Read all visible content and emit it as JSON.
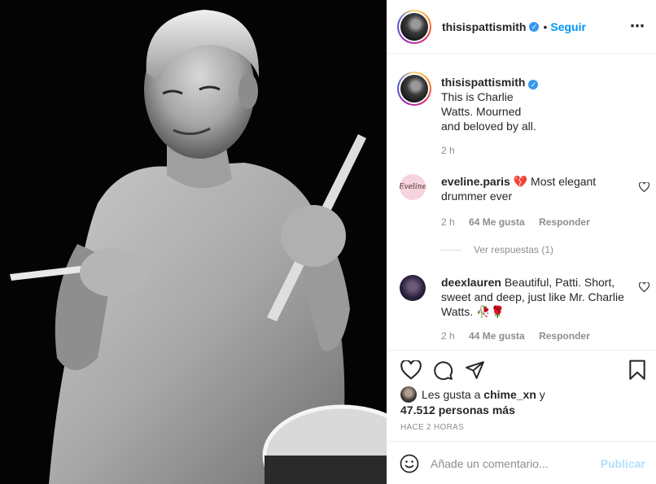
{
  "post": {
    "username": "thisispattismith",
    "verified_mark": "✓",
    "dot": "•",
    "follow_label": "Seguir",
    "more_icon": "⋯",
    "caption_text": "This is Charlie Watts. Mourned and beloved by all.",
    "caption_time": "2 h"
  },
  "comments": [
    {
      "username": "eveline.paris",
      "text": "💔 Most elegant drummer ever",
      "time": "2 h",
      "likes": "64 Me gusta",
      "reply_label": "Responder",
      "avatar_text": "Eveline",
      "view_replies": "Ver respuestas (1)"
    },
    {
      "username": "deexlauren",
      "text": "Beautiful, Patti. Short, sweet and deep, just like Mr. Charlie Watts. 🥀🌹",
      "time": "2 h",
      "likes": "44 Me gusta",
      "reply_label": "Responder"
    }
  ],
  "likes_line": {
    "prefix": "Les gusta a",
    "user": "chime_xn",
    "and": "y",
    "count_text": "47.512 personas más"
  },
  "time_ago": "HACE 2 HORAS",
  "comment_input": {
    "placeholder": "Añade un comentario...",
    "publish_label": "Publicar"
  },
  "colors": {
    "link_blue": "#0095f6",
    "verified_blue": "#3897f0",
    "publish_disabled": "#b2dffc",
    "meta_gray": "#8e8e8e"
  },
  "icons": [
    "heart-icon",
    "comment-icon",
    "share-icon",
    "bookmark-icon",
    "emoji-icon",
    "more-icon",
    "verified-icon"
  ]
}
